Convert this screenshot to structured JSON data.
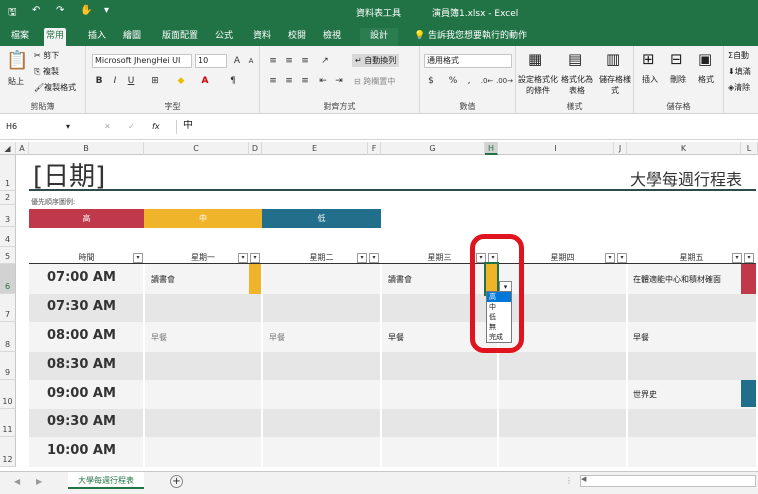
{
  "title": {
    "context_tool": "資料表工具",
    "file": "演員簿1.xlsx - Excel"
  },
  "tabs": [
    {
      "label": "檔案"
    },
    {
      "label": "常用"
    },
    {
      "label": "插入"
    },
    {
      "label": "繪圖"
    },
    {
      "label": "版面配置"
    },
    {
      "label": "公式"
    },
    {
      "label": "資料"
    },
    {
      "label": "校閱"
    },
    {
      "label": "檢視"
    },
    {
      "label": "設計"
    }
  ],
  "tell_me": "告訴我您想要執行的動作",
  "ribbon": {
    "clipboard": {
      "label": "剪貼簿",
      "paste": "貼上",
      "cut": "剪下",
      "copy": "複製",
      "format_painter": "複製格式"
    },
    "font": {
      "label": "字型",
      "name": "Microsoft JhengHei UI",
      "size": "10",
      "bold": "B",
      "italic": "I",
      "underline": "U"
    },
    "alignment": {
      "label": "對齊方式",
      "wrap": "自動換列",
      "merge": "跨欄置中"
    },
    "number": {
      "label": "數值",
      "format": "通用格式",
      "currency": "$",
      "percent": "%",
      "comma": ","
    },
    "styles": {
      "label": "樣式",
      "conditional": "設定格式化的條件",
      "table": "格式化為表格",
      "cell_styles": "儲存格樣式"
    },
    "cells": {
      "label": "儲存格",
      "insert": "插入",
      "delete": "刪除",
      "format": "格式"
    },
    "editing": {
      "autosum": "自動",
      "fill": "填滿",
      "clear": "清除"
    }
  },
  "formula": {
    "name_box": "H6",
    "fx": "fx",
    "value": "中"
  },
  "columns": [
    "A",
    "B",
    "C",
    "D",
    "E",
    "F",
    "G",
    "H",
    "I",
    "J",
    "K",
    "L"
  ],
  "rows": [
    "1",
    "2",
    "3",
    "4",
    "5",
    "6",
    "7",
    "8",
    "9",
    "10",
    "11",
    "12"
  ],
  "sheet": {
    "date_title": "[日期]",
    "schedule_title": "大學每週行程表",
    "legend_label": "優先順序圖例:",
    "legend": [
      {
        "label": "高",
        "color": "#c0394b"
      },
      {
        "label": "中",
        "color": "#f0b42a"
      },
      {
        "label": "低",
        "color": "#226f8c"
      }
    ],
    "headers": {
      "time": "時間",
      "mon": "星期一",
      "tue": "星期二",
      "wed": "星期三",
      "thu": "星期四",
      "fri": "星期五"
    },
    "times": [
      "07:00 AM",
      "07:30 AM",
      "08:00 AM",
      "08:30 AM",
      "09:00 AM",
      "09:30 AM",
      "10:00 AM"
    ],
    "entries": {
      "mon_0700": "讀書會",
      "wed_0700": "讀書會",
      "fri_0700": "在體適能中心和積材確面",
      "mon_0800": "早餐",
      "tue_0800": "早餐",
      "wed_0800": "早餐",
      "fri_0800": "早餐",
      "fri_0900": "世界史"
    },
    "dropdown": [
      "高",
      "中",
      "低",
      "無",
      "完成"
    ]
  },
  "sheet_tab": "大學每週行程表",
  "colors": {
    "accent": "#217346",
    "annotation": "#e0141e"
  }
}
